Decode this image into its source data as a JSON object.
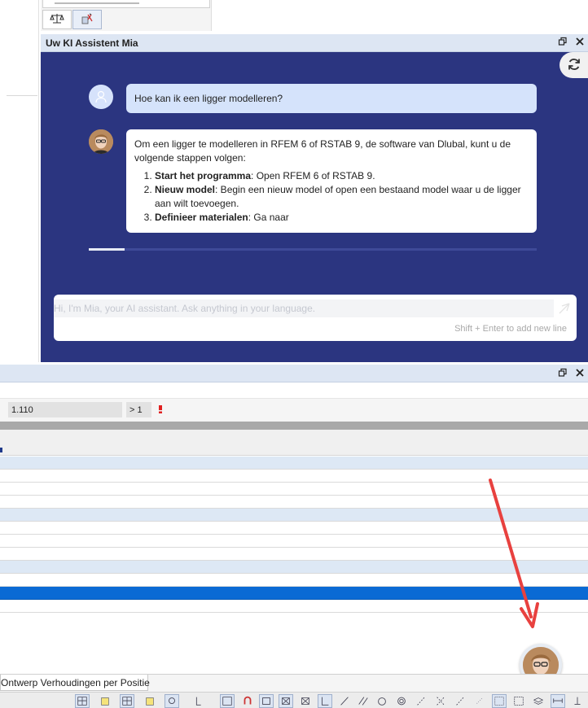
{
  "ai_panel": {
    "title": "Uw KI Assistent Mia",
    "user_message": "Hoe kan ik een ligger modelleren?",
    "assistant_intro": "Om een ligger te modelleren in RFEM 6 of RSTAB 9, de software van Dlubal, kunt u de volgende stappen volgen:",
    "steps": [
      {
        "title": "Start het programma",
        "text": ": Open RFEM 6 of RSTAB 9."
      },
      {
        "title": "Nieuw model",
        "text": ": Begin een nieuw model of open een bestaand model waar u de ligger aan wilt toevoegen."
      },
      {
        "title": "Definieer materialen",
        "text": ": Ga naar"
      }
    ],
    "input_placeholder": "Hi, I'm Mia, your AI assistant. Ask anything in your language.",
    "input_hint": "Shift + Enter to add new line",
    "progress": 0.08
  },
  "table_panel": {
    "filter_value": "1.110",
    "filter_button": "> 1"
  },
  "bottom_tab": "Ontwerp Verhoudingen per Positie",
  "icons": {
    "scale": "balance-icon",
    "tools": "tools-icon",
    "refresh": "refresh-icon",
    "send": "send-icon",
    "restore": "restore-window-icon",
    "close": "close-icon"
  },
  "colors": {
    "panel_bg": "#2b3580",
    "title_bar": "#dde6f3",
    "selected_row": "#0a6ad4",
    "annotation_arrow": "#e8413f"
  }
}
